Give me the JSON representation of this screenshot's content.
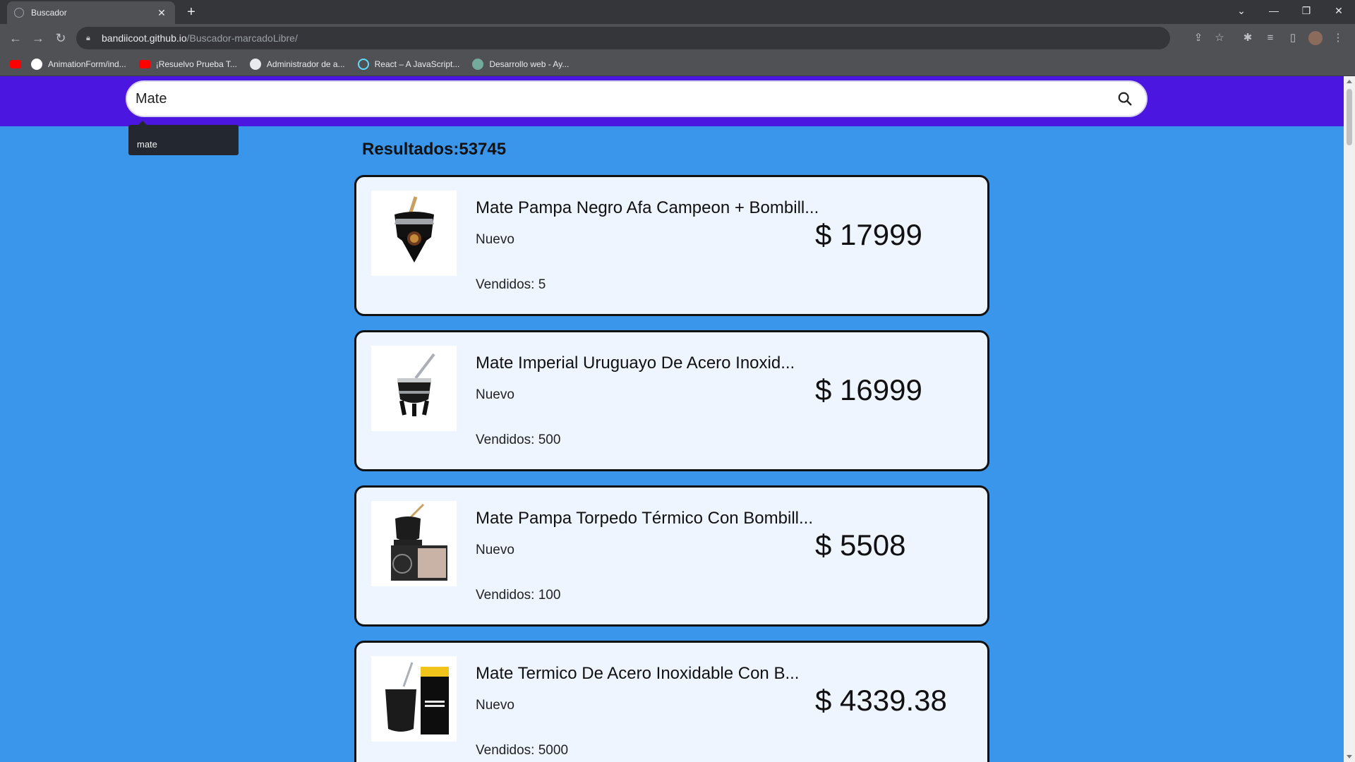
{
  "browser": {
    "tab_title": "Buscador",
    "tab_close": "✕",
    "new_tab": "+",
    "url_host": "bandiicoot.github.io",
    "url_path": "/Buscador-marcadoLibre/",
    "bookmarks": [
      {
        "label": "",
        "icon": "youtube-icon",
        "color": "#ff0000"
      },
      {
        "label": "AnimationForm/ind...",
        "icon": "github-icon",
        "color": "#ffffff"
      },
      {
        "label": "¡Resuelvo Prueba T...",
        "icon": "youtube-icon",
        "color": "#ff0000"
      },
      {
        "label": "Administrador de a...",
        "icon": "globe-icon",
        "color": "#e8eaed"
      },
      {
        "label": "React – A JavaScript...",
        "icon": "react-icon",
        "color": "#61dafb"
      },
      {
        "label": "Desarrollo web - Ay...",
        "icon": "chatgpt-icon",
        "color": "#74aa9c"
      }
    ]
  },
  "search": {
    "value": "Mate",
    "suggestion": "mate"
  },
  "results": {
    "label": "Resultados:53745"
  },
  "products": [
    {
      "name": "Mate Pampa Negro Afa Campeon + Bombill...",
      "condition": "Nuevo",
      "sold": "Vendidos: 5",
      "price": "$ 17999"
    },
    {
      "name": "Mate Imperial Uruguayo De Acero Inoxid...",
      "condition": "Nuevo",
      "sold": "Vendidos: 500",
      "price": "$ 16999"
    },
    {
      "name": "Mate Pampa Torpedo Térmico Con Bombill...",
      "condition": "Nuevo",
      "sold": "Vendidos: 100",
      "price": "$ 5508"
    },
    {
      "name": "Mate Termico De Acero Inoxidable Con B...",
      "condition": "Nuevo",
      "sold": "Vendidos: 5000",
      "price": "$ 4339.38"
    }
  ],
  "colors": {
    "header": "#4c16e1",
    "background": "#3a96ea",
    "card": "#eef5ff"
  }
}
